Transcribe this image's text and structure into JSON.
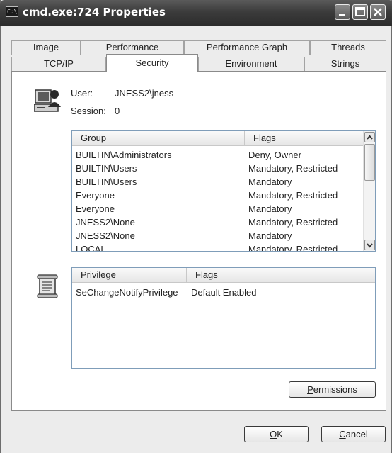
{
  "window": {
    "title": "cmd.exe:724 Properties",
    "icon_text": "C:\\"
  },
  "tabs_row1": [
    {
      "label": "Image"
    },
    {
      "label": "Performance"
    },
    {
      "label": "Performance Graph"
    },
    {
      "label": "Threads"
    }
  ],
  "tabs_row2": [
    {
      "label": "TCP/IP"
    },
    {
      "label": "Security"
    },
    {
      "label": "Environment"
    },
    {
      "label": "Strings"
    }
  ],
  "user_info": {
    "user_label": "User:",
    "user_value": "JNESS2\\jness",
    "session_label": "Session:",
    "session_value": "0"
  },
  "groups_table": {
    "columns": [
      "Group",
      "Flags"
    ],
    "rows": [
      {
        "group": "BUILTIN\\Administrators",
        "flags": "Deny, Owner"
      },
      {
        "group": "BUILTIN\\Users",
        "flags": "Mandatory, Restricted"
      },
      {
        "group": "BUILTIN\\Users",
        "flags": "Mandatory"
      },
      {
        "group": "Everyone",
        "flags": "Mandatory, Restricted"
      },
      {
        "group": "Everyone",
        "flags": "Mandatory"
      },
      {
        "group": "JNESS2\\None",
        "flags": "Mandatory, Restricted"
      },
      {
        "group": "JNESS2\\None",
        "flags": "Mandatory"
      },
      {
        "group": "LOCAL",
        "flags": "Mandatory, Restricted"
      }
    ]
  },
  "privileges_table": {
    "columns": [
      "Privilege",
      "Flags"
    ],
    "rows": [
      {
        "privilege": "SeChangeNotifyPrivilege",
        "flags": "Default Enabled"
      }
    ]
  },
  "buttons": {
    "permissions": {
      "mnemonic": "P",
      "rest": "ermissions"
    },
    "ok": {
      "mnemonic": "O",
      "rest": "K"
    },
    "cancel": {
      "mnemonic": "C",
      "rest": "ancel"
    }
  }
}
